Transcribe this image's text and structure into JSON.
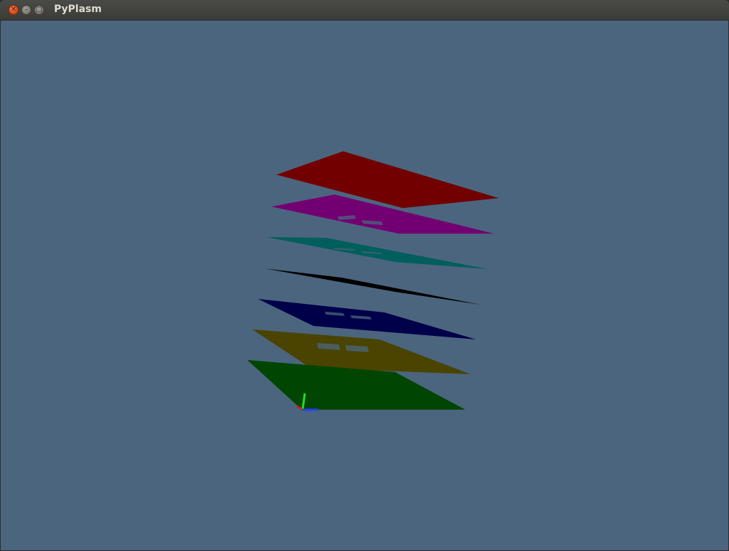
{
  "window": {
    "title": "PyPlasm",
    "controls": {
      "close_glyph": "✕",
      "minimize_glyph": "–",
      "maximize_glyph": "□"
    }
  },
  "viewport": {
    "background": "#4b657e",
    "layers": [
      {
        "name": "layer-red",
        "color": "#720000"
      },
      {
        "name": "layer-purple",
        "color": "#720072"
      },
      {
        "name": "layer-teal",
        "color": "#005e5c"
      },
      {
        "name": "layer-black",
        "color": "#000000"
      },
      {
        "name": "layer-navy",
        "color": "#00004a"
      },
      {
        "name": "layer-olive",
        "color": "#4a4400"
      },
      {
        "name": "layer-green",
        "color": "#004500"
      }
    ],
    "axes": {
      "x_color": "#e01010",
      "y_color": "#20e020",
      "z_color": "#2040ff"
    }
  }
}
